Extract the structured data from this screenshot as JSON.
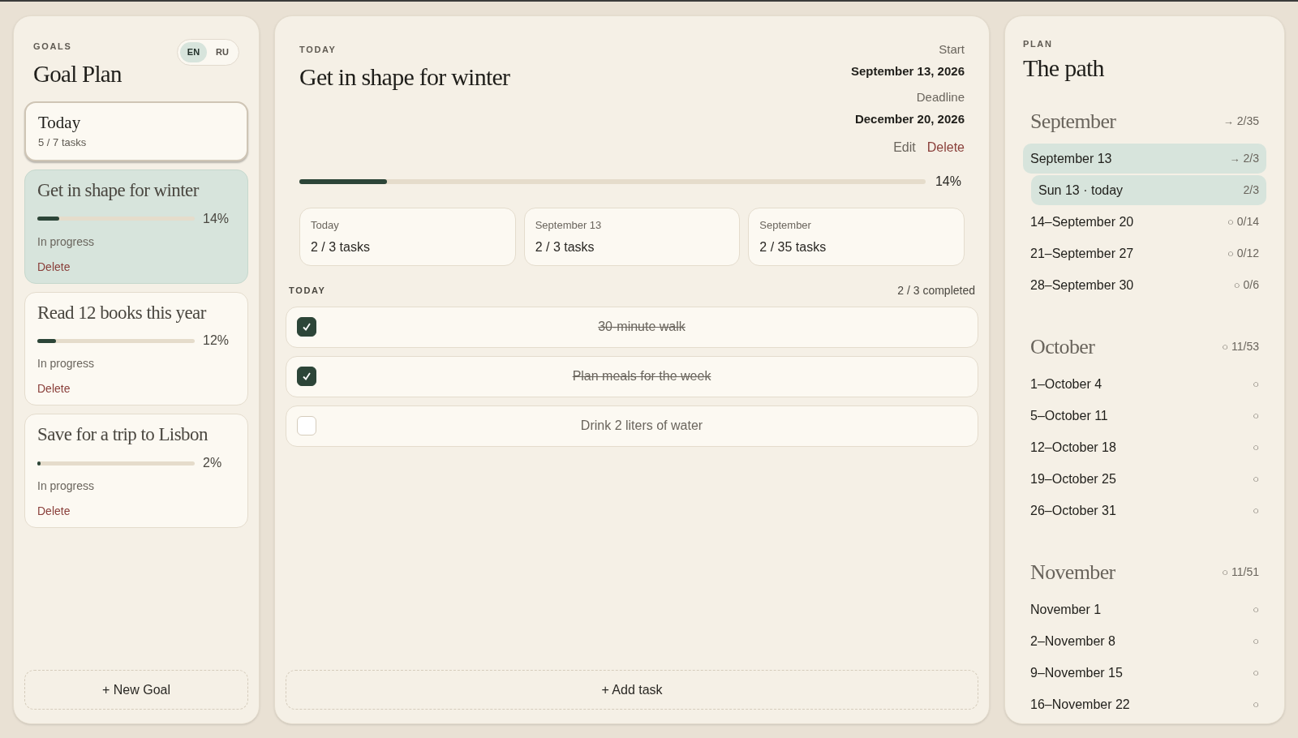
{
  "goals_panel": {
    "eyebrow": "GOALS",
    "title": "Goal Plan",
    "languages": [
      {
        "label": "EN",
        "selected": true
      },
      {
        "label": "RU",
        "selected": false
      }
    ],
    "today_card": {
      "title": "Today",
      "count": "5 / 7 tasks"
    },
    "goals": [
      {
        "title": "Get in shape for winter",
        "level": 0.14,
        "percent": "14%",
        "status": "In progress",
        "delete": "Delete",
        "selected": true
      },
      {
        "title": "Read 12 books this year",
        "level": 0.12,
        "percent": "12%",
        "status": "In progress",
        "delete": "Delete",
        "selected": false
      },
      {
        "title": "Save for a trip to Lisbon",
        "level": 0.02,
        "percent": "2%",
        "status": "In progress",
        "delete": "Delete",
        "selected": false
      }
    ],
    "new_goal": "+ New Goal"
  },
  "goal_detail": {
    "eyebrow": "TODAY",
    "title": "Get in shape for winter",
    "start_label": "Start",
    "start_date": "September 13, 2026",
    "deadline_label": "Deadline",
    "deadline_date": "December 20, 2026",
    "edit": "Edit",
    "delete": "Delete",
    "level": 0.14,
    "percent": "14%",
    "stats": [
      {
        "label": "Today",
        "value": "2 / 3 tasks"
      },
      {
        "label": "September 13",
        "value": "2 / 3 tasks"
      },
      {
        "label": "September",
        "value": "2 / 35 tasks"
      }
    ],
    "tasks_heading": "TODAY",
    "tasks_summary": "2 / 3 completed",
    "tasks": [
      {
        "text": "30-minute walk",
        "checked": true
      },
      {
        "text": "Plan meals for the week",
        "checked": true
      },
      {
        "text": "Drink 2 liters of water",
        "checked": false
      }
    ],
    "add_task": "+ Add task"
  },
  "plan_panel": {
    "eyebrow": "PLAN",
    "title": "The path",
    "months": [
      {
        "name": "September",
        "mark": "→",
        "count": "2/35",
        "weeks": [
          {
            "label": "September 13",
            "mark": "→",
            "count": "2/3",
            "selected": true,
            "children": [
              {
                "label": "Sun 13 · today",
                "count": "2/3",
                "selected": true
              }
            ]
          },
          {
            "label": "14–September 20",
            "mark": "○",
            "count": "0/14",
            "selected": false
          },
          {
            "label": "21–September 27",
            "mark": "○",
            "count": "0/12",
            "selected": false
          },
          {
            "label": "28–September 30",
            "mark": "○",
            "count": "0/6",
            "selected": false
          }
        ]
      },
      {
        "name": "October",
        "mark": "○",
        "count": "11/53",
        "weeks": [
          {
            "label": "1–October 4",
            "mark": "○",
            "selected": false
          },
          {
            "label": "5–October 11",
            "mark": "○",
            "selected": false
          },
          {
            "label": "12–October 18",
            "mark": "○",
            "selected": false
          },
          {
            "label": "19–October 25",
            "mark": "○",
            "selected": false
          },
          {
            "label": "26–October 31",
            "mark": "○",
            "selected": false
          }
        ]
      },
      {
        "name": "November",
        "mark": "○",
        "count": "11/51",
        "weeks": [
          {
            "label": "November 1",
            "mark": "○",
            "selected": false
          },
          {
            "label": "2–November 8",
            "mark": "○",
            "selected": false
          },
          {
            "label": "9–November 15",
            "mark": "○",
            "selected": false
          },
          {
            "label": "16–November 22",
            "mark": "○",
            "selected": false
          }
        ]
      }
    ]
  }
}
